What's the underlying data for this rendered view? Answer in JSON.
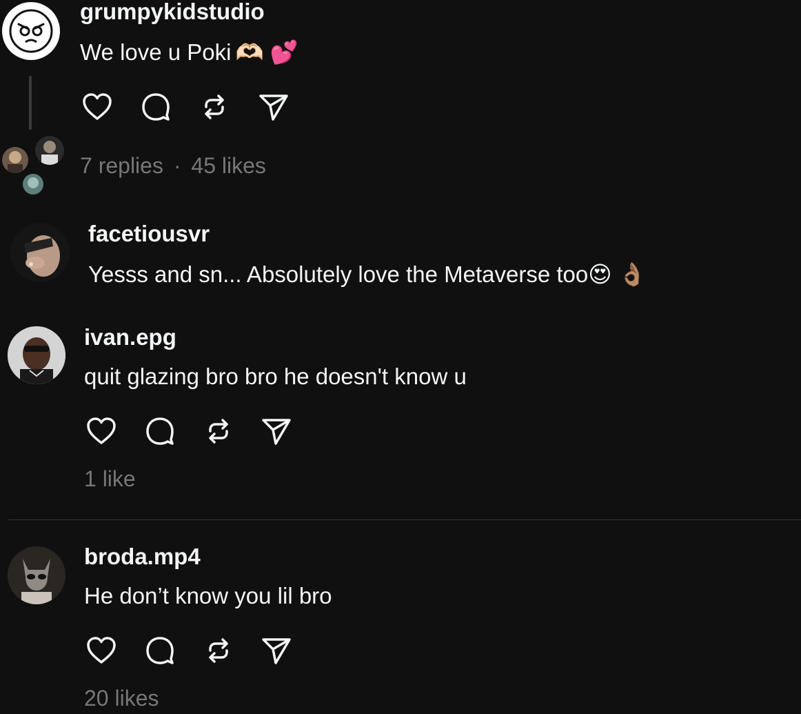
{
  "comments": [
    {
      "username": "grumpykidstudio",
      "text": "We love u Poki",
      "emoji": "🫶🏻 💕",
      "replies": "7 replies",
      "separator": "·",
      "likes": "45 likes"
    },
    {
      "username": "facetiousvr",
      "text": "Yesss and sn... Absolutely love the Metaverse too",
      "emoji": "😍 👌🏽"
    },
    {
      "username": "ivan.epg",
      "text": "quit glazing bro bro he doesn't know u",
      "likes": "1 like"
    },
    {
      "username": "broda.mp4",
      "text": "He don’t know you lil bro",
      "likes": "20 likes"
    }
  ],
  "icons": [
    "heart-icon",
    "comment-icon",
    "repost-icon",
    "share-icon"
  ],
  "colors": {
    "background": "#101010",
    "primary_text": "#f3f5f7",
    "secondary_text": "#777777",
    "heart_emoji": "#f0386b"
  }
}
